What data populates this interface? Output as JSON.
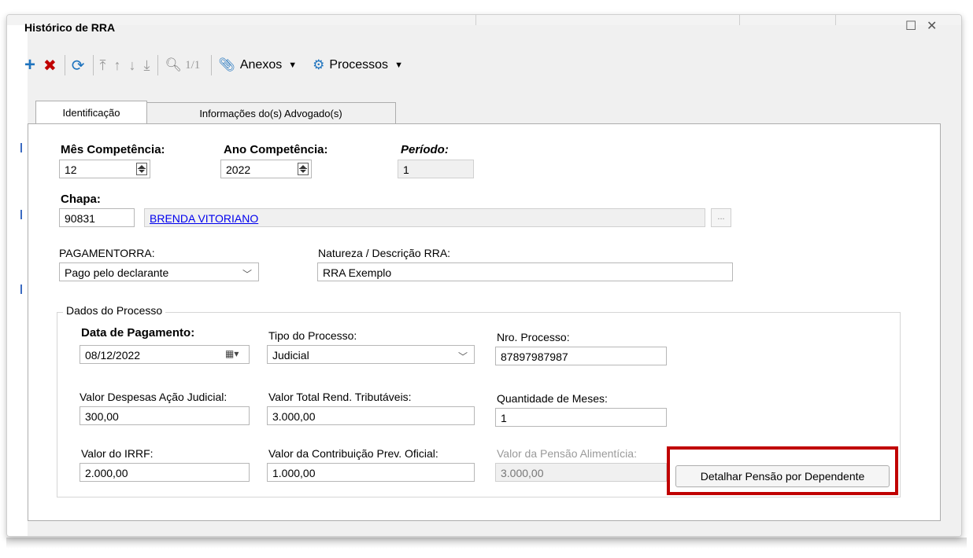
{
  "window": {
    "title": "Histórico de RRA",
    "maximize_glyph": "☐",
    "close_glyph": "✕"
  },
  "toolbar": {
    "page_indicator": "1/1",
    "anexos_label": "Anexos",
    "processos_label": "Processos",
    "icons": [
      "add-icon",
      "delete-icon",
      "refresh-icon",
      "first-record-icon",
      "previous-record-icon",
      "next-record-icon",
      "last-record-icon",
      "search-icon",
      "paperclip-icon",
      "gear-icon"
    ],
    "colors": {
      "add": "#1e73be",
      "delete": "#c00000",
      "refresh": "#1e73be"
    }
  },
  "tabs": [
    {
      "label": "Identificação",
      "active": true
    },
    {
      "label": "Informações do(s) Advogado(s)",
      "active": false
    }
  ],
  "form": {
    "mes_competencia": {
      "label": "Mês Competência:",
      "value": "12"
    },
    "ano_competencia": {
      "label": "Ano Competência:",
      "value": "2022"
    },
    "periodo": {
      "label": "Período:",
      "value": "1"
    },
    "chapa": {
      "label": "Chapa:",
      "value": "90831",
      "name": "BRENDA VITORIANO",
      "lookup": "..."
    },
    "pagamento_rra": {
      "label": "PAGAMENTORRA:",
      "value": "Pago pelo declarante"
    },
    "natureza": {
      "label": "Natureza / Descrição RRA:",
      "value": "RRA Exemplo"
    }
  },
  "processo": {
    "group_label": "Dados do Processo",
    "data_pagamento": {
      "label": "Data de Pagamento:",
      "value": "08/12/2022"
    },
    "tipo_processo": {
      "label": "Tipo do Processo:",
      "value": "Judicial"
    },
    "nro_processo": {
      "label": "Nro. Processo:",
      "value": "87897987987"
    },
    "despesas": {
      "label": "Valor Despesas Ação Judicial:",
      "value": "300,00"
    },
    "total_rend": {
      "label": "Valor Total Rend. Tributáveis:",
      "value": "3.000,00"
    },
    "qtd_meses": {
      "label": "Quantidade de Meses:",
      "value": "1"
    },
    "irrf": {
      "label": "Valor do IRRF:",
      "value": "2.000,00"
    },
    "contribuicao": {
      "label": "Valor da Contribuição Prev. Oficial:",
      "value": "1.000,00"
    },
    "pensao": {
      "label": "Valor da Pensão Alimentícia:",
      "value": "3.000,00"
    },
    "detalhar_button": "Detalhar Pensão por Dependente",
    "highlight_color": "#c00000"
  }
}
